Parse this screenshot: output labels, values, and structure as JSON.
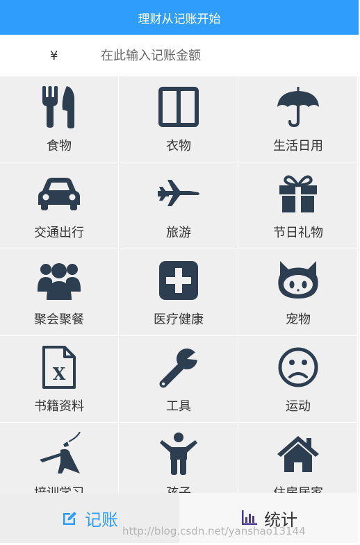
{
  "header": {
    "title": "理财从记账开始"
  },
  "amount": {
    "currency_symbol": "¥",
    "placeholder": "在此输入记账金额",
    "value": ""
  },
  "categories": [
    {
      "label": "食物",
      "icon": "cutlery-icon"
    },
    {
      "label": "衣物",
      "icon": "wardrobe-icon"
    },
    {
      "label": "生活日用",
      "icon": "umbrella-icon"
    },
    {
      "label": "交通出行",
      "icon": "car-icon"
    },
    {
      "label": "旅游",
      "icon": "fighter-jet-icon"
    },
    {
      "label": "节日礼物",
      "icon": "gift-icon"
    },
    {
      "label": "聚会聚餐",
      "icon": "users-icon"
    },
    {
      "label": "医疗健康",
      "icon": "medical-plus-icon"
    },
    {
      "label": "宠物",
      "icon": "github-cat-icon"
    },
    {
      "label": "书籍资料",
      "icon": "excel-file-icon"
    },
    {
      "label": "工具",
      "icon": "wrench-icon"
    },
    {
      "label": "运动",
      "icon": "frown-face-icon"
    },
    {
      "label": "培训学习",
      "icon": "warrior-icon"
    },
    {
      "label": "孩子",
      "icon": "child-icon"
    },
    {
      "label": "住房居家",
      "icon": "home-icon"
    }
  ],
  "tabs": {
    "record": {
      "label": "记账",
      "icon": "edit-icon"
    },
    "stats": {
      "label": "统计",
      "icon": "bar-chart-icon"
    }
  },
  "watermark": "http://blog.csdn.net/yanshao13144",
  "colors": {
    "accent": "#2e9dfb",
    "icon": "#2c3e50",
    "grid_bg": "#efefef"
  }
}
